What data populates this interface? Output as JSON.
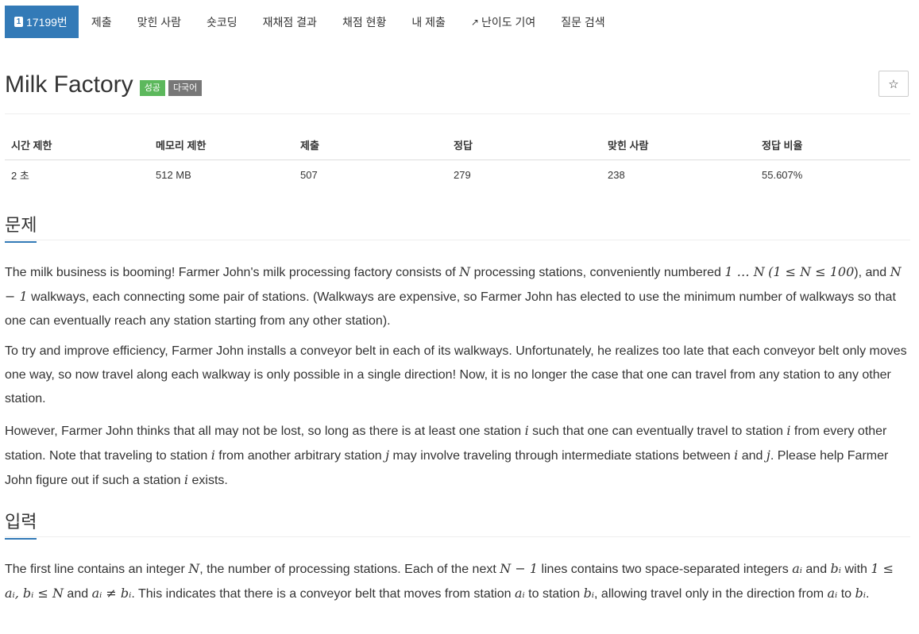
{
  "nav": {
    "problem_number": "17199번",
    "problem_icon": "1",
    "items": [
      "제출",
      "맞힌 사람",
      "숏코딩",
      "재채점 결과",
      "채점 현황",
      "내 제출",
      "난이도 기여",
      "질문 검색"
    ]
  },
  "problem": {
    "title": "Milk Factory",
    "badge_success": "성공",
    "badge_lang": "다국어",
    "star": "☆"
  },
  "info_table": {
    "headers": [
      "시간 제한",
      "메모리 제한",
      "제출",
      "정답",
      "맞힌 사람",
      "정답 비율"
    ],
    "values": [
      "2 초",
      "512 MB",
      "507",
      "279",
      "238",
      "55.607%"
    ]
  },
  "sections": {
    "problem_heading": "문제",
    "input_heading": "입력"
  },
  "text": {
    "p1_a": "The milk business is booming! Farmer John's milk processing factory consists of ",
    "p1_b": " processing stations, conveniently numbered ",
    "p1_c": "), and ",
    "p1_d": " walkways, each connecting some pair of stations. (Walkways are expensive, so Farmer John has elected to use the minimum number of walkways so that one can eventually reach any station starting from any other station).",
    "p2": "To try and improve efficiency, Farmer John installs a conveyor belt in each of its walkways. Unfortunately, he realizes too late that each conveyor belt only moves one way, so now travel along each walkway is only possible in a single direction! Now, it is no longer the case that one can travel from any station to any other station.",
    "p3_a": "However, Farmer John thinks that all may not be lost, so long as there is at least one station ",
    "p3_b": " such that one can eventually travel to station ",
    "p3_c": " from every other station. Note that traveling to station ",
    "p3_d": " from another arbitrary station ",
    "p3_e": " may involve traveling through intermediate stations between ",
    "p3_f": " and ",
    "p3_g": ". Please help Farmer John figure out if such a station ",
    "p3_h": " exists.",
    "in_a": "The first line contains an integer ",
    "in_b": ", the number of processing stations. Each of the next ",
    "in_c": " lines contains two space-separated integers ",
    "in_d": " and ",
    "in_e": " with ",
    "in_f": " and ",
    "in_g": ". This indicates that there is a conveyor belt that moves from station ",
    "in_h": " to station ",
    "in_i": ", allowing travel only in the direction from ",
    "in_j": " to ",
    "in_k": "."
  },
  "math": {
    "N": "N",
    "range": "1 … N",
    "constraint": "(1 ≤ N ≤ 100",
    "nminus1": "N − 1",
    "i": "i",
    "j": "j",
    "ai": "aᵢ",
    "bi": "bᵢ",
    "bounds": "1 ≤ aᵢ, bᵢ ≤ N",
    "neq": "aᵢ ≠ bᵢ"
  }
}
